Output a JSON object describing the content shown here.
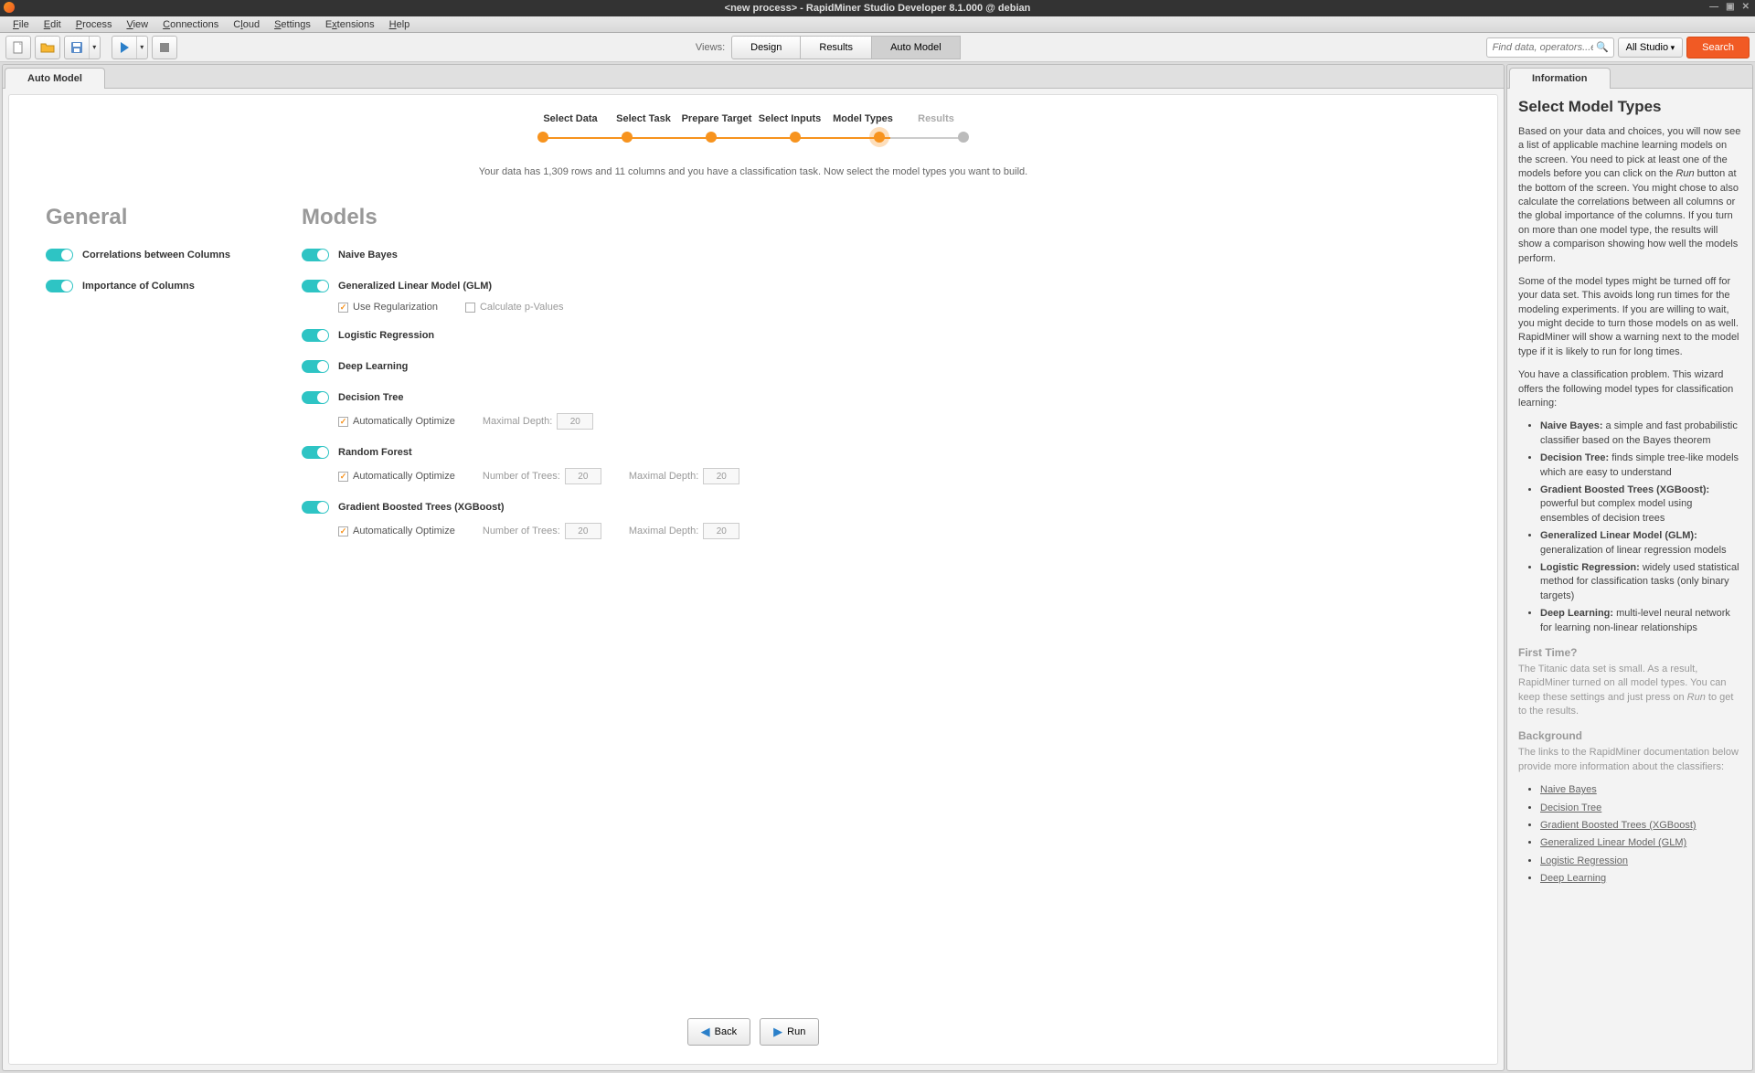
{
  "titlebar": {
    "title": "<new process> - RapidMiner Studio Developer 8.1.000 @ debian"
  },
  "menubar": {
    "items": [
      "File",
      "Edit",
      "Process",
      "View",
      "Connections",
      "Cloud",
      "Settings",
      "Extensions",
      "Help"
    ]
  },
  "toolbar": {
    "views_label": "Views:",
    "views": [
      "Design",
      "Results",
      "Auto Model"
    ],
    "active_view": "Auto Model",
    "search_placeholder": "Find data, operators...etc",
    "scope_label": "All Studio",
    "search_btn": "Search"
  },
  "main_tab": {
    "label": "Auto Model"
  },
  "steps": {
    "labels": [
      "Select Data",
      "Select Task",
      "Prepare Target",
      "Select Inputs",
      "Model Types",
      "Results"
    ],
    "current_index": 4
  },
  "instructions": "Your data has 1,309 rows and 11 columns and you have a classification task.  Now select the model types you want to build.",
  "general": {
    "title": "General",
    "items": [
      {
        "label": "Correlations between Columns",
        "on": true
      },
      {
        "label": "Importance of Columns",
        "on": true
      }
    ]
  },
  "models": {
    "title": "Models",
    "items": [
      {
        "label": "Naive Bayes",
        "on": true,
        "subs": []
      },
      {
        "label": "Generalized Linear Model (GLM)",
        "on": true,
        "subs": [
          {
            "type": "check",
            "label": "Use Regularization",
            "checked": true,
            "active": true
          },
          {
            "type": "check",
            "label": "Calculate p-Values",
            "checked": false,
            "active": false
          }
        ]
      },
      {
        "label": "Logistic Regression",
        "on": true,
        "subs": []
      },
      {
        "label": "Deep Learning",
        "on": true,
        "subs": []
      },
      {
        "label": "Decision Tree",
        "on": true,
        "subs": [
          {
            "type": "check",
            "label": "Automatically Optimize",
            "checked": true,
            "active": true
          },
          {
            "type": "num",
            "label": "Maximal Depth:",
            "value": "20",
            "active": false
          }
        ]
      },
      {
        "label": "Random Forest",
        "on": true,
        "subs": [
          {
            "type": "check",
            "label": "Automatically Optimize",
            "checked": true,
            "active": true
          },
          {
            "type": "num",
            "label": "Number of Trees:",
            "value": "20",
            "active": false
          },
          {
            "type": "num",
            "label": "Maximal Depth:",
            "value": "20",
            "active": false
          }
        ]
      },
      {
        "label": "Gradient Boosted Trees (XGBoost)",
        "on": true,
        "subs": [
          {
            "type": "check",
            "label": "Automatically Optimize",
            "checked": true,
            "active": true
          },
          {
            "type": "num",
            "label": "Number of Trees:",
            "value": "20",
            "active": false
          },
          {
            "type": "num",
            "label": "Maximal Depth:",
            "value": "20",
            "active": false
          }
        ]
      }
    ]
  },
  "nav": {
    "back": "Back",
    "run": "Run"
  },
  "info_tab": {
    "label": "Information"
  },
  "info": {
    "heading": "Select Model Types",
    "p1a": "Based on your data and choices, you will now see a list of applicable machine learning models on the screen. You need to pick at least one of the models before you can click on the ",
    "p1b": "Run",
    "p1c": " button at the bottom of the screen. You might chose to also calculate the correlations between all columns or the global importance of the columns. If you turn on more than one model type, the results will show a comparison showing how well the models perform.",
    "p2": "Some of the model types might be turned off for your data set. This avoids long run times for the modeling experiments. If you are willing to wait, you might decide to turn those models on as well. RapidMiner will show a warning next to the model type if it is likely to run for long times.",
    "p3": "You have a classification problem. This wizard offers the following model types for classification learning:",
    "model_desc": [
      {
        "b": "Naive Bayes:",
        "t": " a simple and fast probabilistic classifier based on the Bayes theorem"
      },
      {
        "b": "Decision Tree:",
        "t": " finds simple tree-like models which are easy to understand"
      },
      {
        "b": "Gradient Boosted Trees (XGBoost):",
        "t": " powerful but complex model using ensembles of decision trees"
      },
      {
        "b": "Generalized Linear Model (GLM):",
        "t": " generalization of linear regression models"
      },
      {
        "b": "Logistic Regression:",
        "t": " widely used statistical method for classification tasks (only binary targets)"
      },
      {
        "b": "Deep Learning:",
        "t": " multi-level neural network for learning non-linear relationships"
      }
    ],
    "first_h": "First Time?",
    "first_a": "The Titanic data set is small. As a result, RapidMiner turned on all model types. You can keep these settings and just press on ",
    "first_b": "Run",
    "first_c": " to get to the results.",
    "bg_h": "Background",
    "bg_p": "The links to the RapidMiner documentation below provide more information about the classifiers:",
    "links": [
      "Naive Bayes",
      "Decision Tree",
      "Gradient Boosted Trees (XGBoost)",
      "Generalized Linear Model (GLM)",
      "Logistic Regression",
      "Deep Learning"
    ]
  }
}
